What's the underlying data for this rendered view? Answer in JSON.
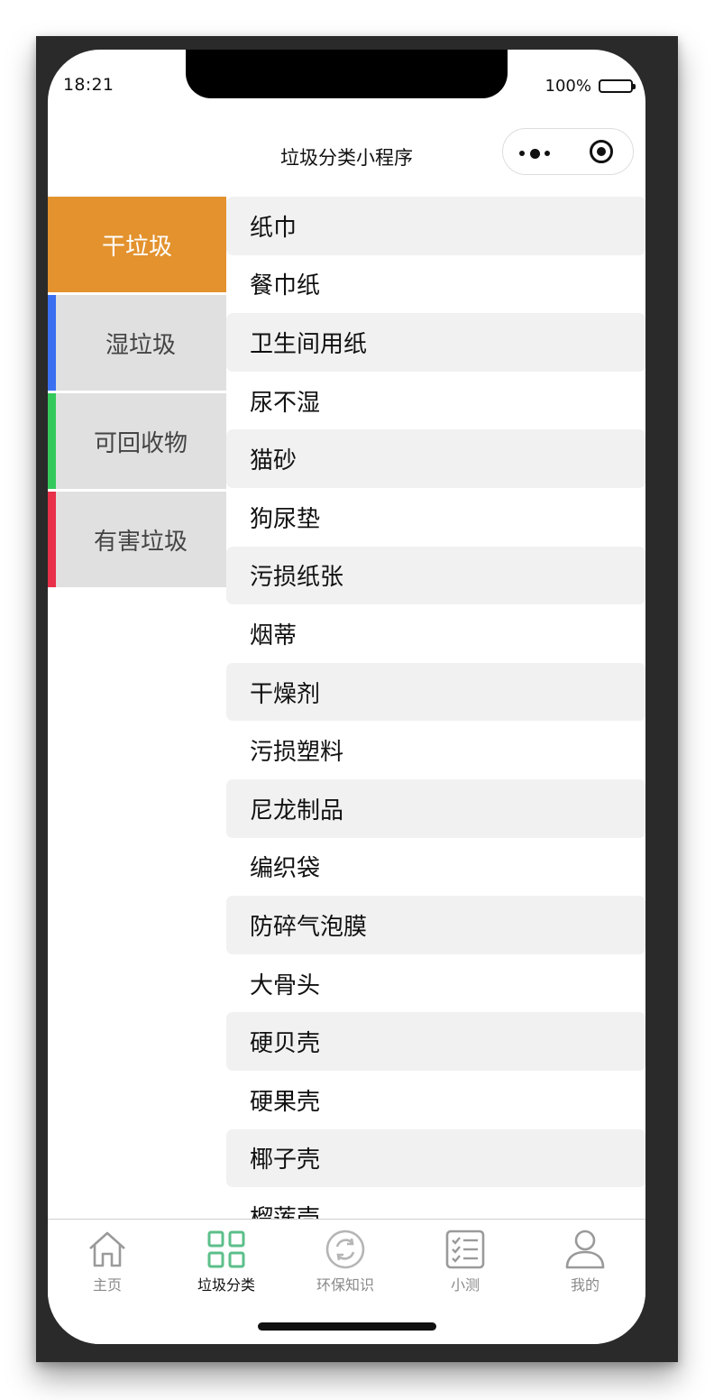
{
  "status_bar": {
    "time": "18:21",
    "battery": "100%"
  },
  "nav": {
    "title": "垃圾分类小程序"
  },
  "categories": [
    {
      "label": "干垃圾",
      "active": true,
      "accent": "#e3922e"
    },
    {
      "label": "湿垃圾",
      "active": false,
      "accent": "#3b6ff2"
    },
    {
      "label": "可回收物",
      "active": false,
      "accent": "#35c95c"
    },
    {
      "label": "有害垃圾",
      "active": false,
      "accent": "#e8304a"
    }
  ],
  "items": [
    "纸巾",
    "餐巾纸",
    "卫生间用纸",
    "尿不湿",
    "猫砂",
    "狗尿垫",
    "污损纸张",
    "烟蒂",
    "干燥剂",
    "污损塑料",
    "尼龙制品",
    "编织袋",
    "防碎气泡膜",
    "大骨头",
    "硬贝壳",
    "硬果壳",
    "椰子壳",
    "榴莲壳"
  ],
  "tabbar": {
    "tabs": [
      {
        "label": "主页",
        "icon": "home-icon",
        "active": false
      },
      {
        "label": "垃圾分类",
        "icon": "grid-icon",
        "active": true
      },
      {
        "label": "环保知识",
        "icon": "recycle-icon",
        "active": false
      },
      {
        "label": "小测",
        "icon": "checklist-icon",
        "active": false
      },
      {
        "label": "我的",
        "icon": "user-icon",
        "active": false
      }
    ]
  },
  "colors": {
    "active_category": "#e3922e",
    "active_tab_icon": "#5bbf8a",
    "inactive": "#8a8a8a"
  }
}
